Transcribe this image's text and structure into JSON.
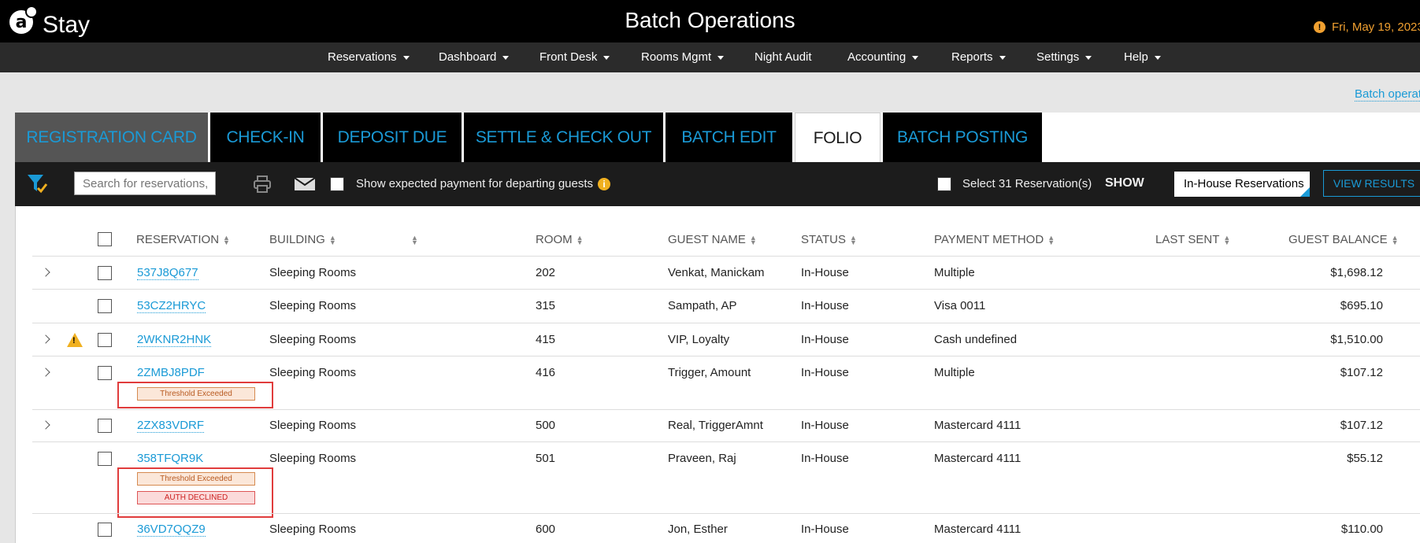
{
  "header": {
    "logo_letter": "a",
    "logo_text": "Stay",
    "title": "Batch Operations",
    "date": "Fri, May 19, 2023"
  },
  "nav": [
    {
      "label": "Reservations",
      "dropdown": true
    },
    {
      "label": "Dashboard",
      "dropdown": true
    },
    {
      "label": "Front Desk",
      "dropdown": true
    },
    {
      "label": "Rooms Mgmt",
      "dropdown": true
    },
    {
      "label": "Night Audit",
      "dropdown": false
    },
    {
      "label": "Accounting",
      "dropdown": true
    },
    {
      "label": "Reports",
      "dropdown": true
    },
    {
      "label": "Settings",
      "dropdown": true
    },
    {
      "label": "Help",
      "dropdown": true
    }
  ],
  "batch_link": "Batch operations",
  "tabs": [
    {
      "label": "REGISTRATION CARD"
    },
    {
      "label": "CHECK-IN"
    },
    {
      "label": "DEPOSIT DUE"
    },
    {
      "label": "SETTLE & CHECK OUT"
    },
    {
      "label": "BATCH EDIT"
    },
    {
      "label": "FOLIO",
      "active": true
    },
    {
      "label": "BATCH POSTING"
    }
  ],
  "toolbar": {
    "search_placeholder": "Search for reservations, guests",
    "show_expected_label": "Show expected payment for departing guests",
    "select_label": "Select 31 Reservation(s)",
    "show_label": "SHOW",
    "show_value": "In-House Reservations",
    "view_results": "VIEW RESULTS"
  },
  "columns": {
    "reservation": "RESERVATION",
    "building": "BUILDING",
    "room": "ROOM",
    "guest_name": "GUEST NAME",
    "status": "STATUS",
    "payment_method": "PAYMENT METHOD",
    "last_sent": "LAST SENT",
    "guest_balance": "GUEST BALANCE"
  },
  "rows": [
    {
      "id": "537J8Q677",
      "building": "Sleeping Rooms",
      "room": "202",
      "guest": "Venkat, Manickam",
      "status": "In-House",
      "payment": "Multiple",
      "balance": "$1,698.12"
    },
    {
      "id": "53CZ2HRYC",
      "building": "Sleeping Rooms",
      "room": "315",
      "guest": "Sampath, AP",
      "status": "In-House",
      "payment": "Visa 0011",
      "balance": "$695.10"
    },
    {
      "id": "2WKNR2HNK",
      "building": "Sleeping Rooms",
      "room": "415",
      "guest": "VIP, Loyalty",
      "status": "In-House",
      "payment": "Cash undefined",
      "balance": "$1,510.00"
    },
    {
      "id": "2ZMBJ8PDF",
      "building": "Sleeping Rooms",
      "room": "416",
      "guest": "Trigger, Amount",
      "status": "In-House",
      "payment": "Multiple",
      "balance": "$107.12",
      "badge1": "Threshold Exceeded"
    },
    {
      "id": "2ZX83VDRF",
      "building": "Sleeping Rooms",
      "room": "500",
      "guest": "Real, TriggerAmnt",
      "status": "In-House",
      "payment": "Mastercard 4111",
      "balance": "$107.12"
    },
    {
      "id": "358TFQR9K",
      "building": "Sleeping Rooms",
      "room": "501",
      "guest": "Praveen, Raj",
      "status": "In-House",
      "payment": "Mastercard 4111",
      "balance": "$55.12",
      "badge1": "Threshold Exceeded",
      "badge2": "AUTH DECLINED"
    },
    {
      "id": "36VD7QQZ9",
      "building": "Sleeping Rooms",
      "room": "600",
      "guest": "Jon, Esther",
      "status": "In-House",
      "payment": "Mastercard 4111",
      "balance": "$110.00"
    }
  ],
  "colors": {
    "accent": "#1a9ad6",
    "warning": "#f0a030",
    "declined": "#cc2222"
  }
}
